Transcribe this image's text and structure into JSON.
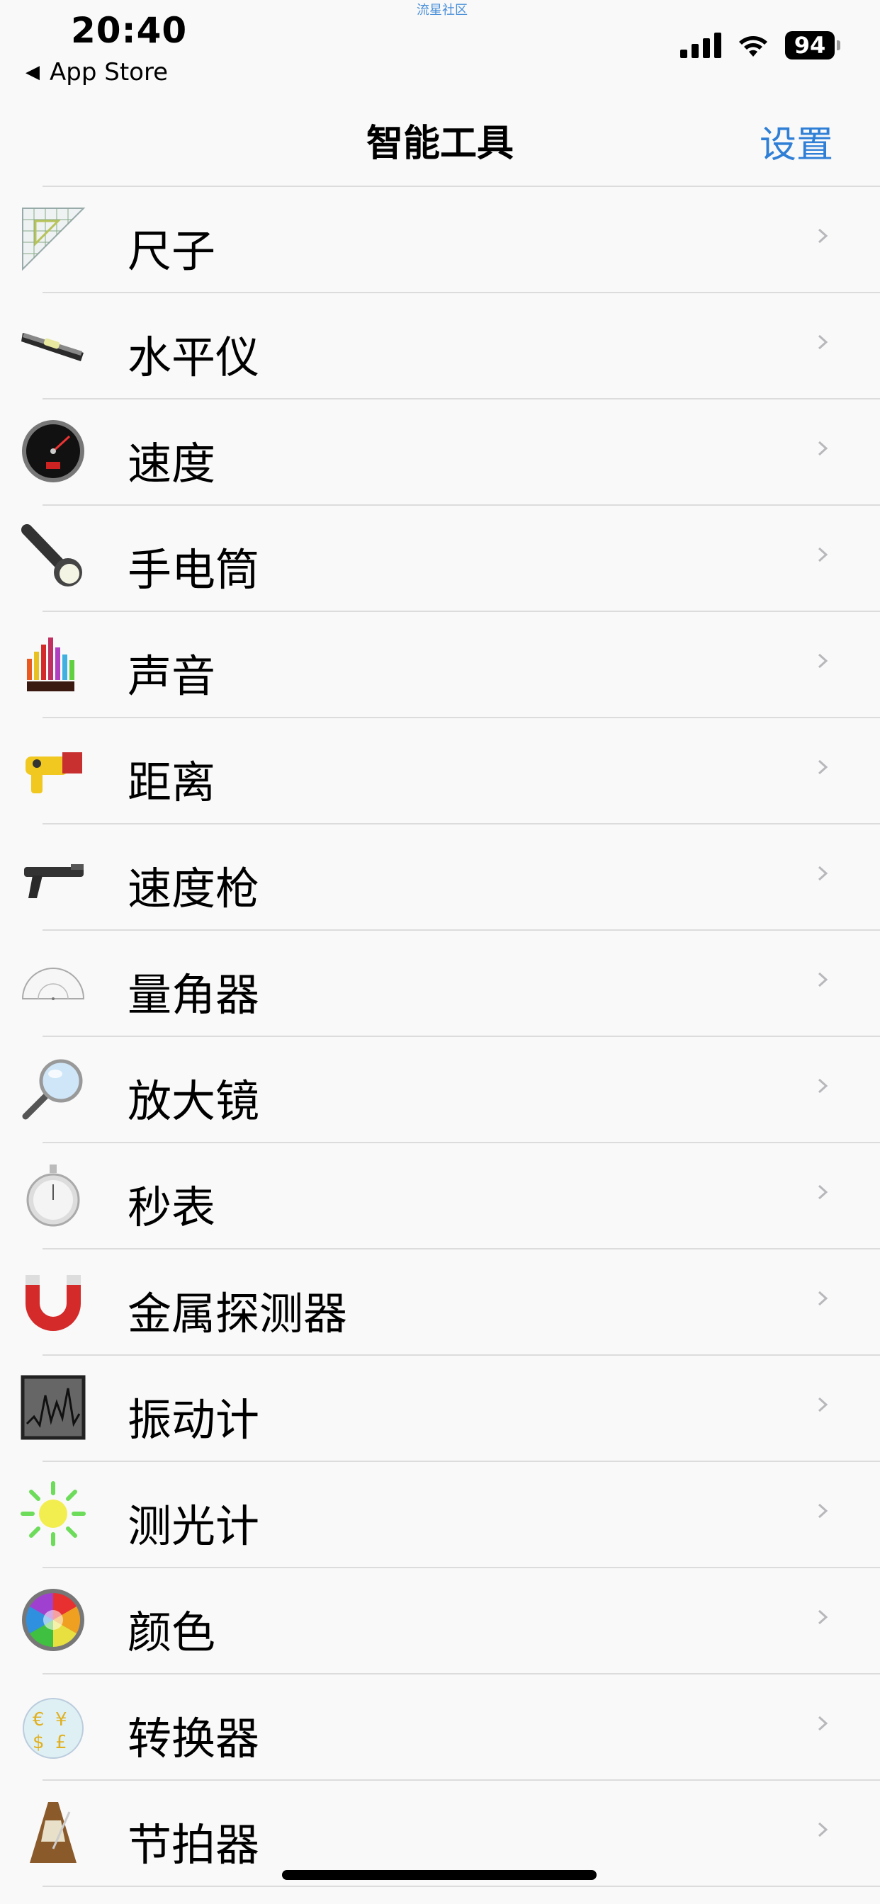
{
  "status": {
    "time": "20:40",
    "back_label": "App Store",
    "watermark": "流星社区",
    "battery": "94"
  },
  "nav": {
    "title": "智能工具",
    "settings_label": "设置"
  },
  "tools": [
    {
      "label": "尺子",
      "icon": "ruler-icon"
    },
    {
      "label": "水平仪",
      "icon": "spirit-level-icon"
    },
    {
      "label": "速度",
      "icon": "speedometer-icon"
    },
    {
      "label": "手电筒",
      "icon": "flashlight-icon"
    },
    {
      "label": "声音",
      "icon": "sound-meter-icon"
    },
    {
      "label": "距离",
      "icon": "distance-gun-icon"
    },
    {
      "label": "速度枪",
      "icon": "speed-gun-icon"
    },
    {
      "label": "量角器",
      "icon": "protractor-icon"
    },
    {
      "label": "放大镜",
      "icon": "magnifier-icon"
    },
    {
      "label": "秒表",
      "icon": "stopwatch-icon"
    },
    {
      "label": "金属探测器",
      "icon": "magnet-icon"
    },
    {
      "label": "振动计",
      "icon": "seismometer-icon"
    },
    {
      "label": "测光计",
      "icon": "light-meter-icon"
    },
    {
      "label": "颜色",
      "icon": "color-wheel-icon"
    },
    {
      "label": "转换器",
      "icon": "currency-converter-icon"
    },
    {
      "label": "节拍器",
      "icon": "metronome-icon"
    }
  ],
  "colors": {
    "accent": "#2f7fd6",
    "separator": "#dcdcdc",
    "background": "#f9f9f9"
  }
}
